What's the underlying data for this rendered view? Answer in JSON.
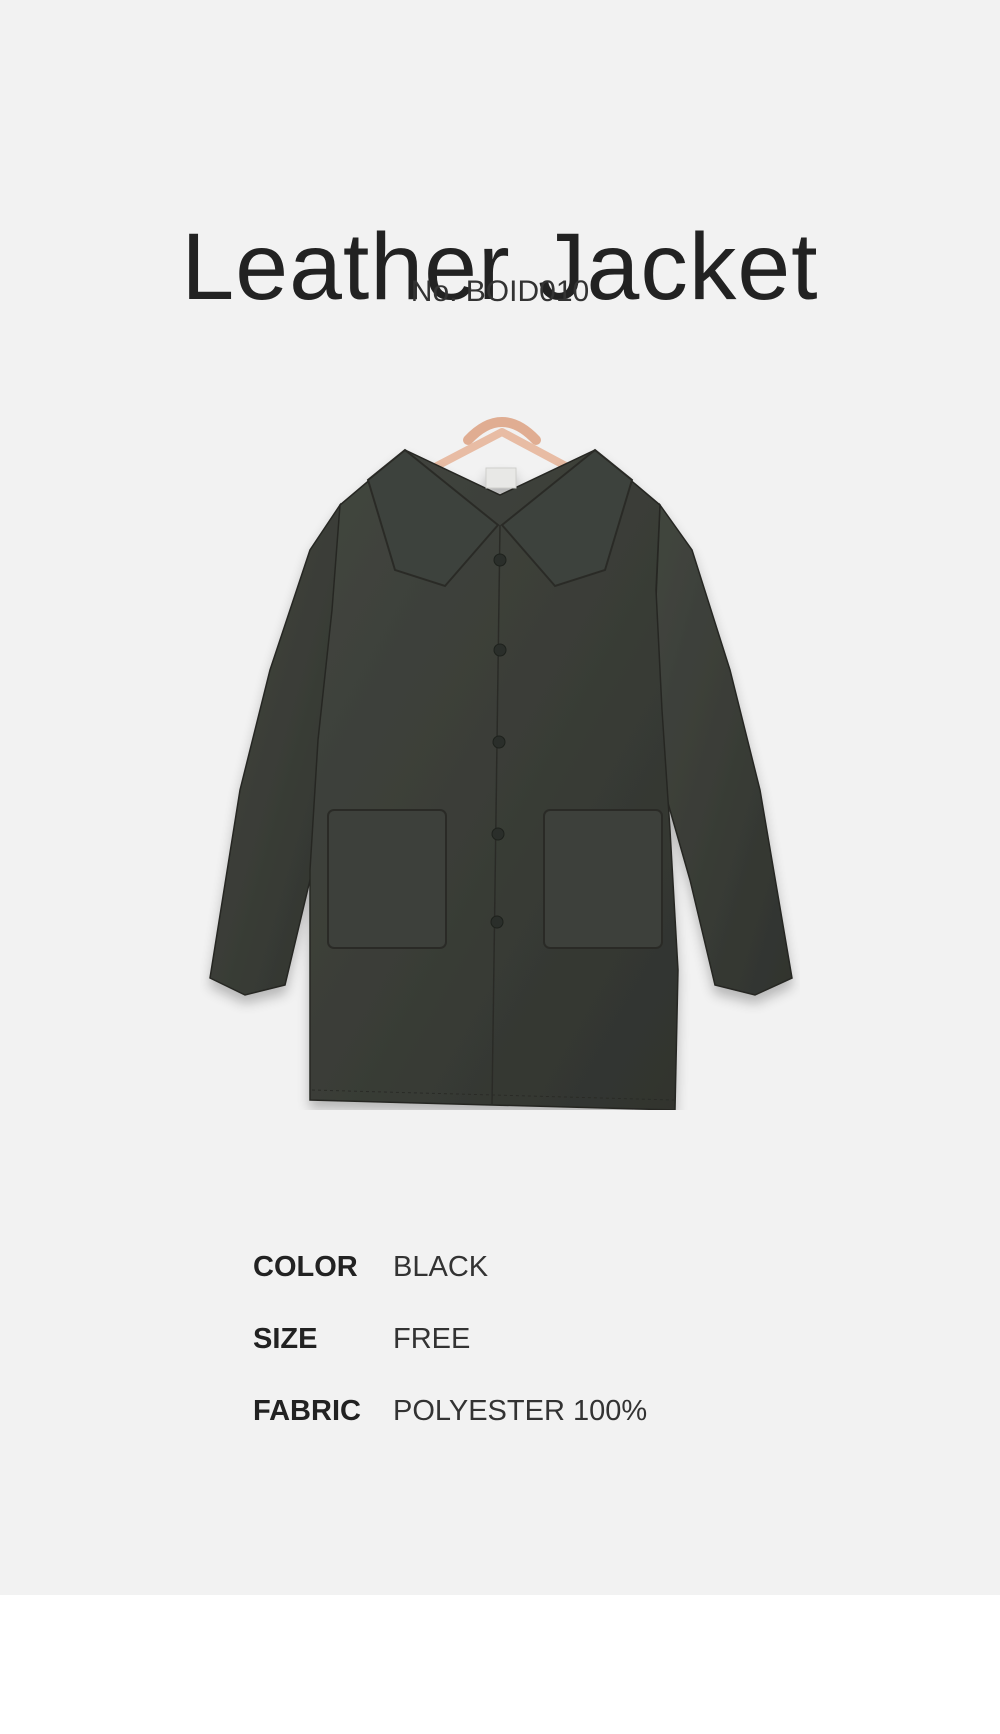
{
  "product": {
    "title": "Leather Jacket",
    "number": "No. BOID010"
  },
  "specs": [
    {
      "label": "COLOR",
      "value": "BLACK"
    },
    {
      "label": "SIZE",
      "value": "FREE"
    },
    {
      "label": "FABRIC",
      "value": "POLYESTER 100%"
    }
  ],
  "colors": {
    "background": "#f2f2f2",
    "jacket": "#3a3d38",
    "hanger": "#e8b9a0",
    "text": "#222222"
  },
  "icons": {
    "product_image": "leather-jacket-on-hanger"
  }
}
